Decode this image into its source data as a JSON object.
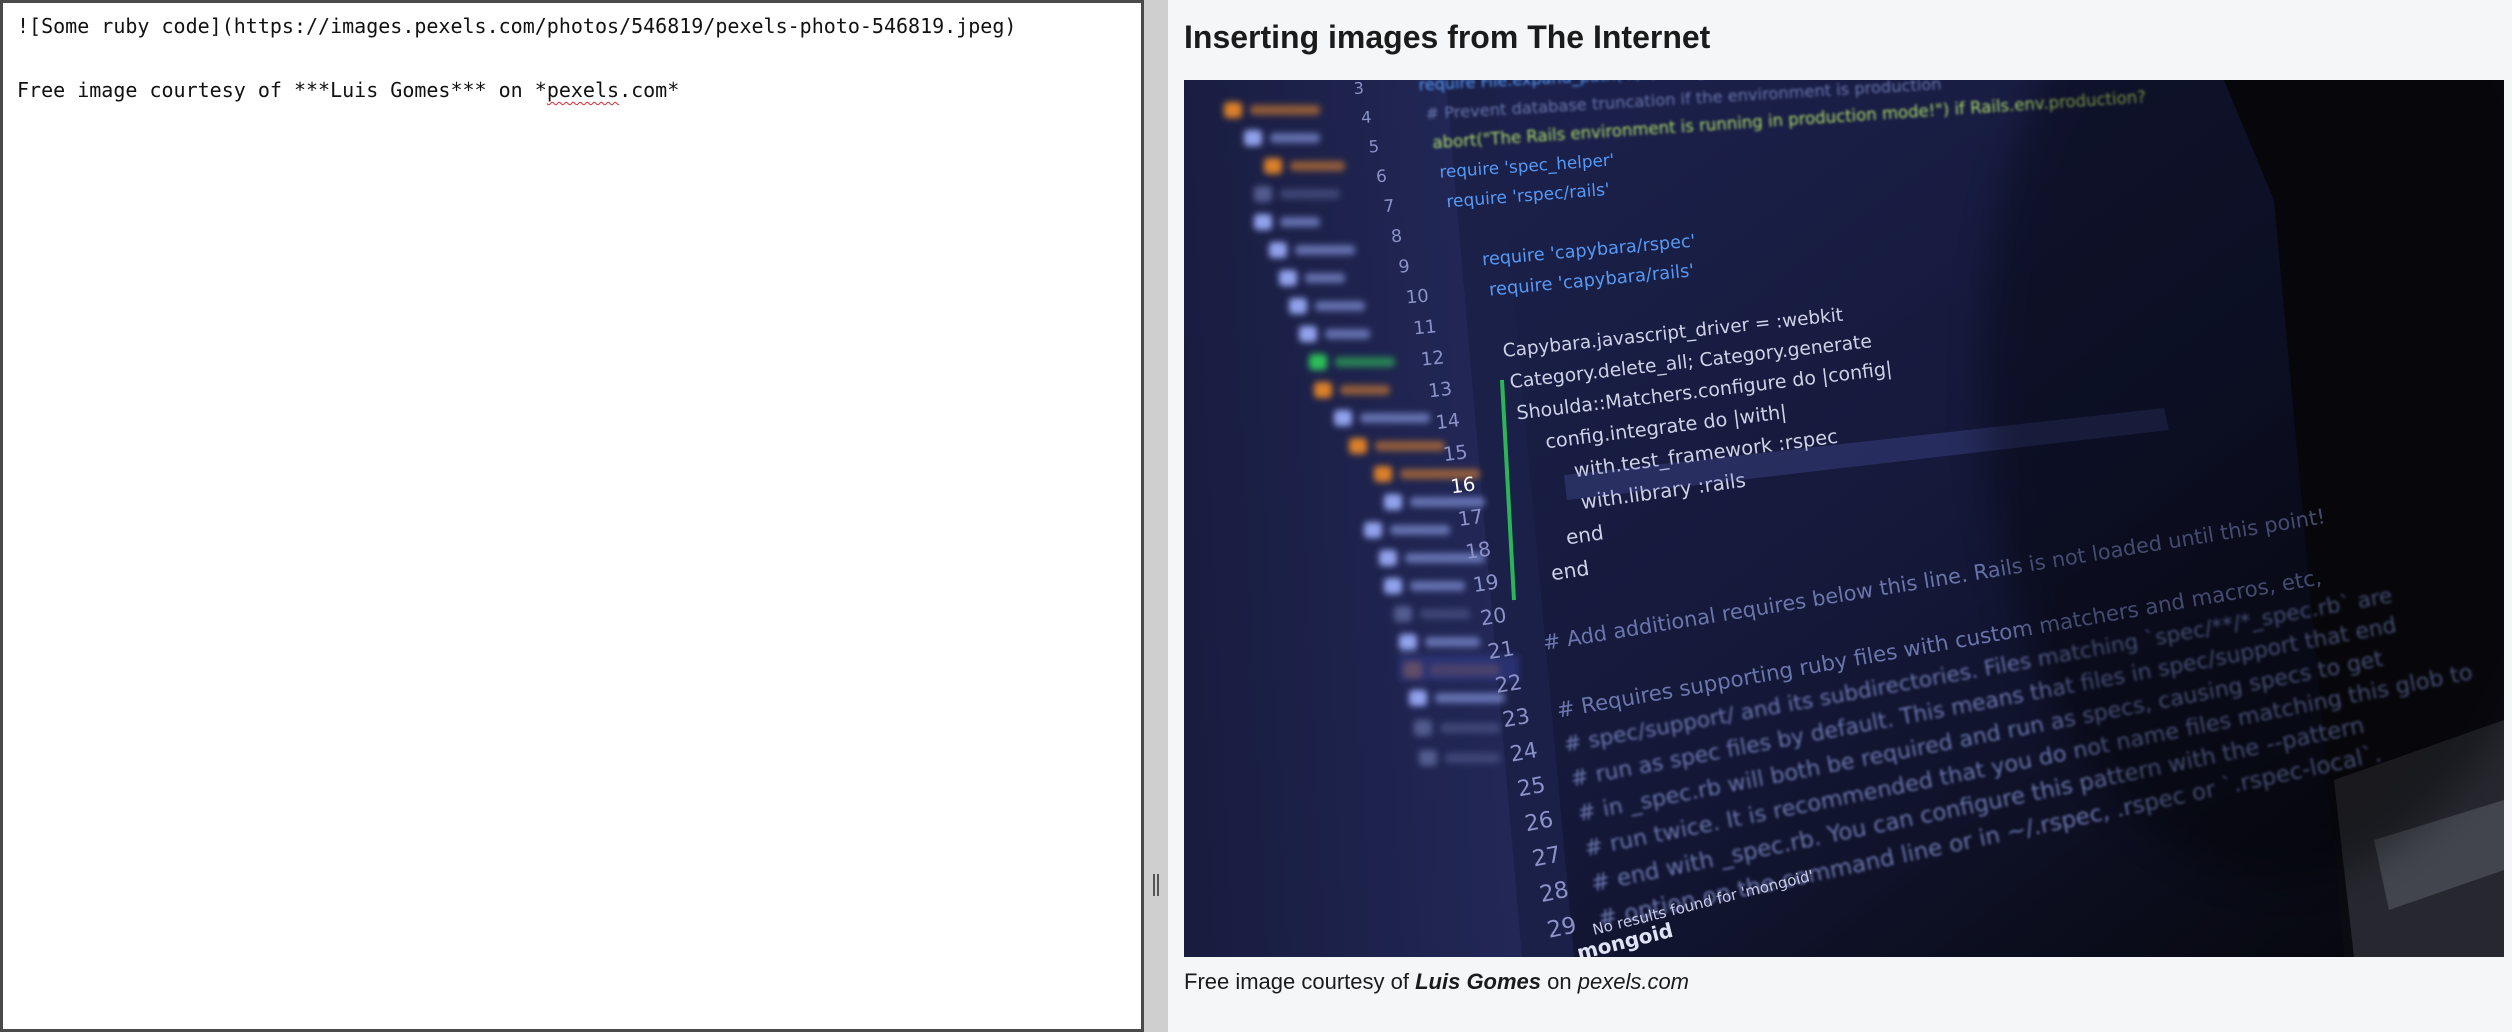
{
  "editor": {
    "lines": [
      "![Some ruby code](https://images.pexels.com/photos/546819/pexels-photo-546819.jpeg)",
      "",
      "Free image courtesy of ***Luis Gomes*** on *pexels.com*"
    ],
    "line3_prefix": "Free image courtesy of ***Luis Gomes*** on *",
    "line3_spell": "pexels",
    "line3_suffix": ".com*"
  },
  "preview": {
    "title": "Inserting images from The Internet",
    "image_alt": "Some ruby code",
    "caption_prefix": "Free image courtesy of ",
    "caption_author": "Luis Gomes",
    "caption_middle": " on ",
    "caption_site": "pexels.com"
  },
  "photo_code": {
    "line_numbers": [
      "3",
      "4",
      "5",
      "6",
      "7",
      "8",
      "9",
      "10",
      "11",
      "12",
      "13",
      "14",
      "15",
      "16",
      "17",
      "18",
      "19",
      "20",
      "21",
      "22",
      "23",
      "24",
      "25",
      "26",
      "27",
      "28",
      "29"
    ],
    "code_lines": [
      "require File.expand_path('../../config/environment', __FILE__)",
      "# Prevent database truncation if the environment is production",
      "abort(\"The Rails environment is running in production mode!\") if Rails.env.production?",
      "require 'spec_helper'",
      "require 'rspec/rails'",
      "",
      "require 'capybara/rspec'",
      "require 'capybara/rails'",
      "",
      "Capybara.javascript_driver = :webkit",
      "Category.delete_all; Category.generate",
      "Shoulda::Matchers.configure do |config|",
      "config.integrate do |with|",
      "with.test_framework :rspec",
      "with.library :rails",
      "end",
      "end",
      "",
      "# Add additional requires below this line. Rails is not loaded until this point!",
      "",
      "# Requires supporting ruby files with custom matchers and macros, etc,",
      "# spec/support/ and its subdirectories. Files matching `spec/**/*_spec.rb` are",
      "# run as spec files by default. This means that files in spec/support that end",
      "# in _spec.rb will both be required and run as specs, causing specs to get",
      "# run twice. It is recommended that you do not name files matching this glob to",
      "# end with _spec.rb. You can configure this pattern with the --pattern",
      "# option on the command line or in ~/.rspec, .rspec or `.rspec-local`."
    ],
    "status_text": "No results found for 'mongoid'",
    "bottom_text": "mongoid",
    "colors": {
      "keyword": "#5aa0ff",
      "string": "#b6e36a",
      "comment": "#6f7bb3",
      "plain": "#d8dcf0",
      "orange": "#f08a24",
      "green": "#2fd05a"
    }
  }
}
